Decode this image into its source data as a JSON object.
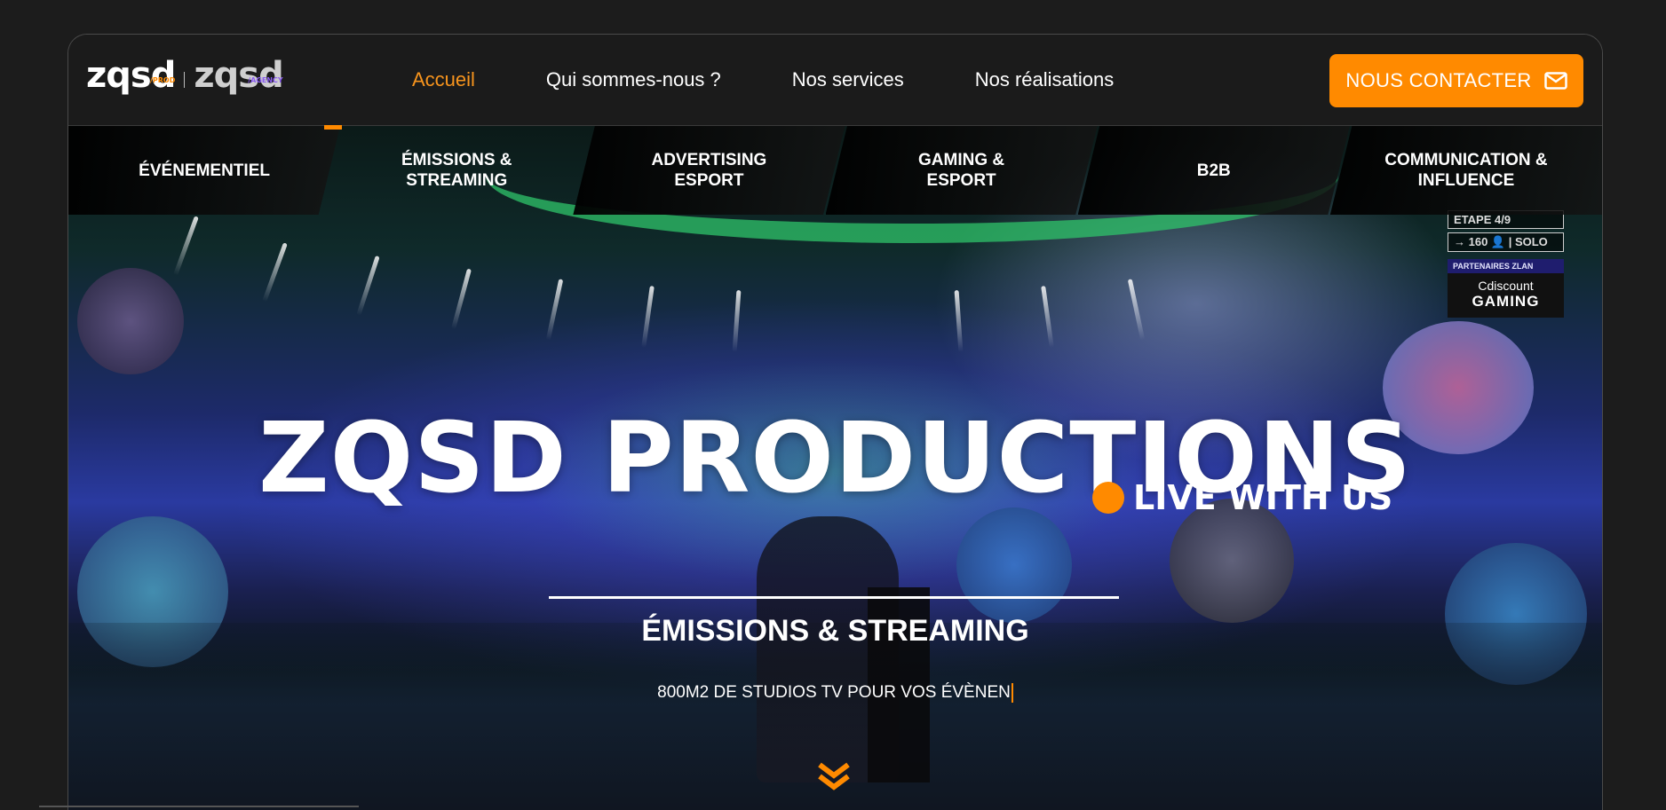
{
  "logo": {
    "prod_word": "zqsd",
    "prod_sub": "/PROD",
    "agency_word": "zqsd",
    "agency_sub": "/AGENCY"
  },
  "nav": {
    "items": [
      {
        "label": "Accueil",
        "active": true
      },
      {
        "label": "Qui sommes-nous ?"
      },
      {
        "label": "Nos services"
      },
      {
        "label": "Nos réalisations"
      }
    ],
    "cta_label": "NOUS CONTACTER",
    "cta_icon": "mail-icon"
  },
  "subnav": {
    "items": [
      {
        "label": "ÉVÉNEMENTIEL"
      },
      {
        "label": "ÉMISSIONS & STREAMING",
        "active": true
      },
      {
        "label": "ADVERTISING ESPORT"
      },
      {
        "label": "GAMING & ESPORT"
      },
      {
        "label": "B2B"
      },
      {
        "label": "COMMUNICATION & INFLUENCE"
      }
    ]
  },
  "overlay": {
    "stage": "ETAPE 4/9",
    "players": "→ 160 👤 | SOLO",
    "partner": "PARTENAIRES ZLAN",
    "brand_top": "Cdiscount",
    "brand_bottom": "GAMING"
  },
  "hero": {
    "title": "ZQSD PRODUCTIONS",
    "tagline": "LIVE WITH US",
    "section_title": "ÉMISSIONS & STREAMING",
    "section_subtitle": "800M2 DE STUDIOS TV POUR VOS ÉVÈNEN"
  },
  "colors": {
    "accent": "#ff8a00",
    "background": "#1b1b1b",
    "text": "#ffffff"
  }
}
